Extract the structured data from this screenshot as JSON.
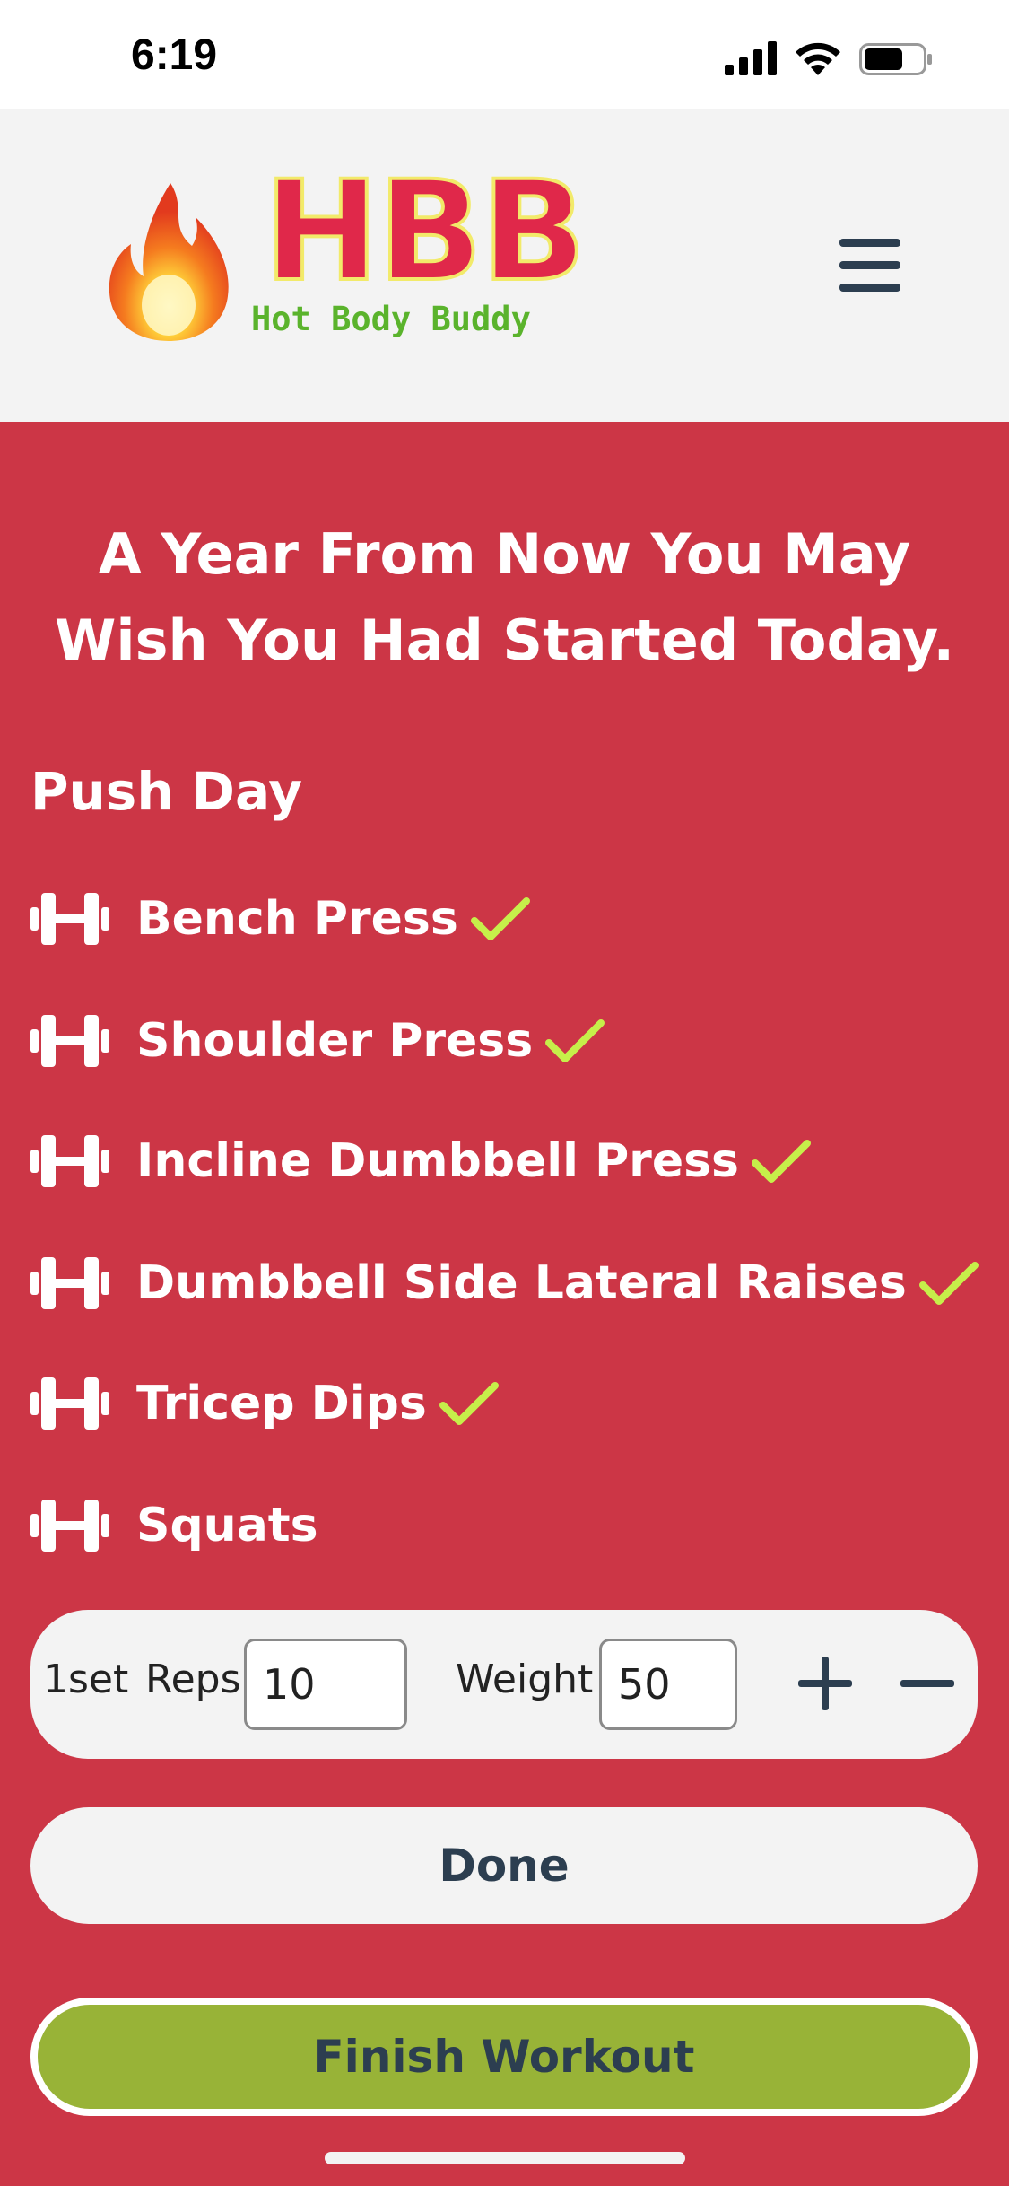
{
  "status_bar": {
    "time": "6:19"
  },
  "header": {
    "logo_title": "HBB",
    "logo_subtitle": "Hot Body Buddy"
  },
  "quote": "A Year From Now You May Wish You Had Started Today.",
  "workout": {
    "title": "Push Day",
    "exercises": [
      {
        "name": "Bench Press",
        "completed": true
      },
      {
        "name": "Shoulder Press",
        "completed": true
      },
      {
        "name": "Incline Dumbbell Press",
        "completed": true
      },
      {
        "name": "Dumbbell Side Lateral Raises",
        "completed": true
      },
      {
        "name": "Tricep Dips",
        "completed": true
      },
      {
        "name": "Squats",
        "completed": false
      }
    ]
  },
  "set_entry": {
    "set_label": "1set",
    "reps_label": "Reps",
    "reps_value": "10",
    "weight_label": "Weight",
    "weight_value": "50"
  },
  "buttons": {
    "done": "Done",
    "finish": "Finish Workout"
  },
  "colors": {
    "background": "#cc3646",
    "header": "#f3f3f3",
    "check": "#c6ef4a",
    "finish_button": "#98b337",
    "text_dark": "#2c3e50"
  }
}
